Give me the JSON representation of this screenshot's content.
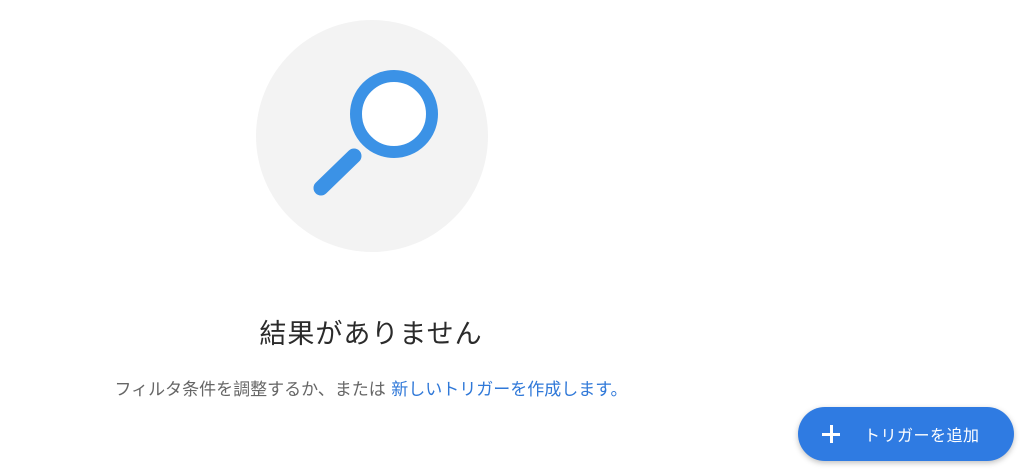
{
  "empty_state": {
    "illustration_icon": "search-icon",
    "title": "結果がありません",
    "hint_prefix": "フィルタ条件を調整するか、または ",
    "hint_link": "新しいトリガーを作成します。"
  },
  "fab": {
    "icon": "plus-icon",
    "label": "トリガーを追加"
  },
  "colors": {
    "accent": "#2f7be2",
    "link": "#2f78d8",
    "magnifier": "#3b92e6",
    "illustration_bg": "#f3f3f3"
  }
}
